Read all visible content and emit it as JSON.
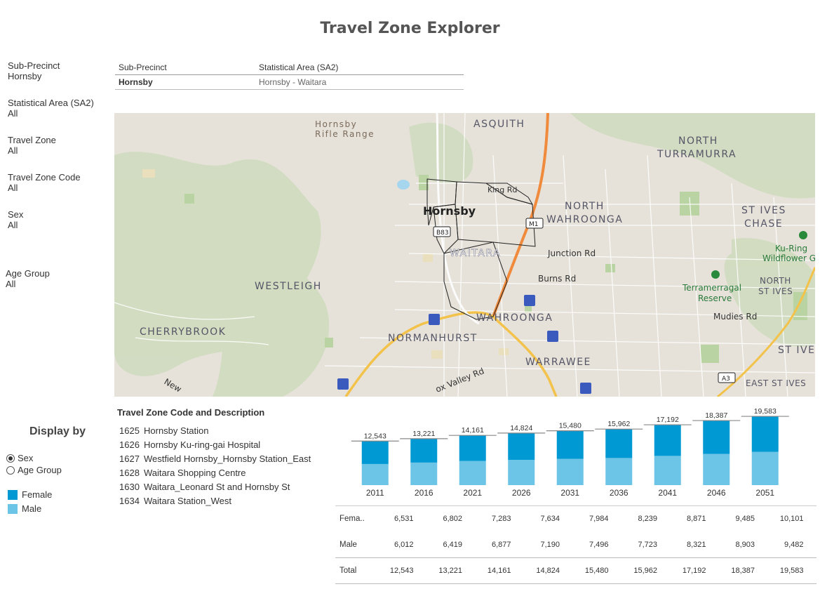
{
  "title": "Travel Zone Explorer",
  "filters": [
    {
      "label": "Sub-Precinct",
      "value": "Hornsby"
    },
    {
      "label": "Statistical Area (SA2)",
      "value": "All"
    },
    {
      "label": "Travel Zone",
      "value": "All"
    },
    {
      "label": "Travel Zone Code",
      "value": "All"
    },
    {
      "label": "Sex",
      "value": "All"
    },
    {
      "label": "Age Group",
      "value": "All"
    }
  ],
  "header_table": {
    "col1": "Sub-Precinct",
    "col2": "Statistical Area (SA2)",
    "row": {
      "sub_precinct": "Hornsby",
      "sa2": "Hornsby - Waitara"
    }
  },
  "map": {
    "labels": {
      "rifle": "Hornsby\nRifle Range",
      "asquith": "ASQUITH",
      "north_turramurra": "NORTH",
      "north_turramurra2": "TURRAMURRA",
      "hornsby": "Hornsby",
      "king_rd": "King Rd",
      "north_wahroonga": "NORTH",
      "north_wahroonga2": "WAHROONGA",
      "st_ives_chase": "ST IVES",
      "st_ives_chase2": "CHASE",
      "kuring": "Ku-Ring",
      "kuring2": "Wildflower G",
      "m1": "M1",
      "b83": "B83",
      "waitara": "WAITARA",
      "junction": "Junction Rd",
      "burns": "Burns Rd",
      "westleigh": "WESTLEIGH",
      "terramerragal": "Terramerragal",
      "terramerragal2": "Reserve",
      "north_st_ives": "NORTH",
      "north_st_ives2": "ST IVES",
      "cherrybrook": "CHERRYBROOK",
      "wahroonga": "WAHROONGA",
      "mudies": "Mudies Rd",
      "normanhurst": "NORMANHURST",
      "st_ive": "ST IVE",
      "warrawee": "WARRAWEE",
      "new": "New",
      "fox": "ox Valley Rd",
      "a3": "A3",
      "east_st_ives": "EAST ST IVES"
    }
  },
  "display_by": {
    "title": "Display by",
    "options": [
      "Sex",
      "Age Group"
    ],
    "selected": "Sex"
  },
  "legend": [
    {
      "label": "Female",
      "color": "#0099d4"
    },
    {
      "label": "Male",
      "color": "#6cc4e6"
    }
  ],
  "travel_zones": {
    "title": "Travel Zone Code and Description",
    "items": [
      {
        "code": "1625",
        "desc": "Hornsby Station"
      },
      {
        "code": "1626",
        "desc": "Hornsby Ku-ring-gai Hospital"
      },
      {
        "code": "1627",
        "desc": "Westfield Hornsby_Hornsby Station_East"
      },
      {
        "code": "1628",
        "desc": "Waitara Shopping Centre"
      },
      {
        "code": "1630",
        "desc": "Waitara_Leonard St and Hornsby St"
      },
      {
        "code": "1634",
        "desc": "Waitara Station_West"
      }
    ]
  },
  "chart_data": {
    "type": "bar",
    "stacked": true,
    "categories": [
      "2011",
      "2016",
      "2021",
      "2026",
      "2031",
      "2036",
      "2041",
      "2046",
      "2051"
    ],
    "series": [
      {
        "name": "Female",
        "values": [
          6531,
          6802,
          7283,
          7634,
          7984,
          8239,
          8871,
          9485,
          10101
        ]
      },
      {
        "name": "Male",
        "values": [
          6012,
          6419,
          6877,
          7190,
          7496,
          7723,
          8321,
          8903,
          9482
        ]
      }
    ],
    "totals": [
      "12,543",
      "13,221",
      "14,161",
      "14,824",
      "15,480",
      "15,962",
      "17,192",
      "18,387",
      "19,583"
    ],
    "colors": {
      "Female": "#0099d4",
      "Male": "#6cc4e6"
    },
    "ylim": [
      0,
      20000
    ]
  },
  "table": {
    "rows": [
      {
        "label": "Fema..",
        "values": [
          "6,531",
          "6,802",
          "7,283",
          "7,634",
          "7,984",
          "8,239",
          "8,871",
          "9,485",
          "10,101"
        ]
      },
      {
        "label": "Male",
        "values": [
          "6,012",
          "6,419",
          "6,877",
          "7,190",
          "7,496",
          "7,723",
          "8,321",
          "8,903",
          "9,482"
        ]
      },
      {
        "label": "Total",
        "values": [
          "12,543",
          "13,221",
          "14,161",
          "14,824",
          "15,480",
          "15,962",
          "17,192",
          "18,387",
          "19,583"
        ]
      }
    ]
  }
}
